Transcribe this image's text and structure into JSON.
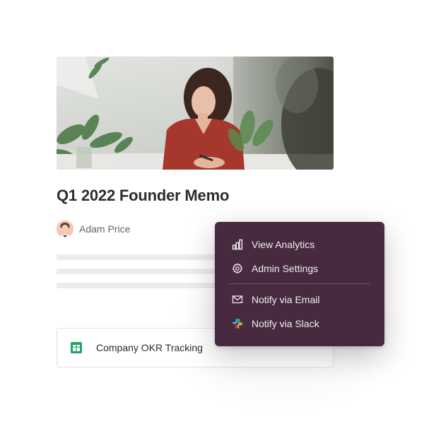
{
  "document": {
    "title": "Q1 2022 Founder Memo",
    "author": "Adam Price"
  },
  "linked_item": {
    "label": "Company OKR Tracking",
    "icon": "google-sheets-icon"
  },
  "menu": {
    "background": "#472a3f",
    "items": [
      {
        "label": "View Analytics",
        "icon": "bar-chart-icon"
      },
      {
        "label": "Admin Settings",
        "icon": "gear-icon"
      },
      {
        "label": "Notify via Email",
        "icon": "email-icon"
      },
      {
        "label": "Notify via Slack",
        "icon": "slack-icon"
      }
    ]
  }
}
